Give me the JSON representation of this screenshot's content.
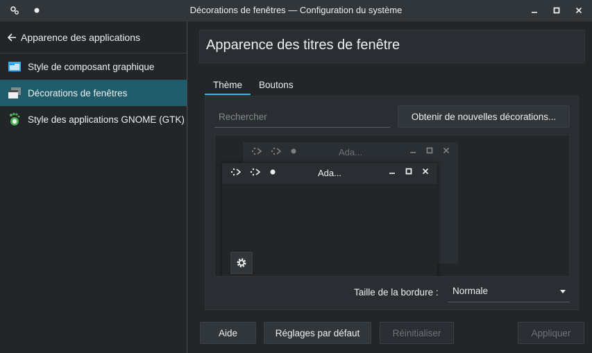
{
  "window": {
    "title": "Décorations de fenêtres — Configuration du système"
  },
  "sidebar": {
    "header": "Apparence des applications",
    "items": [
      {
        "label": "Style de composant graphique",
        "icon": "widget-style-icon"
      },
      {
        "label": "Décorations de fenêtres",
        "icon": "window-decorations-icon",
        "active": true
      },
      {
        "label": "Style des applications GNOME (GTK)",
        "icon": "gtk-foot-icon"
      }
    ]
  },
  "main": {
    "title": "Apparence des titres de fenêtre",
    "tabs": [
      {
        "label": "Thème",
        "active": true
      },
      {
        "label": "Boutons",
        "active": false
      }
    ],
    "search_placeholder": "Rechercher",
    "get_new_label": "Obtenir de nouvelles décorations...",
    "preview": {
      "back_window_title": "Ada...",
      "front_window_title": "Ada..."
    },
    "border_size_label": "Taille de la bordure :",
    "border_size_value": "Normale"
  },
  "footer": {
    "help": "Aide",
    "defaults": "Réglages par défaut",
    "reset": "Réinitialiser",
    "apply": "Appliquer"
  },
  "colors": {
    "accent": "#3daee9",
    "selection": "#205c6a",
    "background": "#232629"
  }
}
